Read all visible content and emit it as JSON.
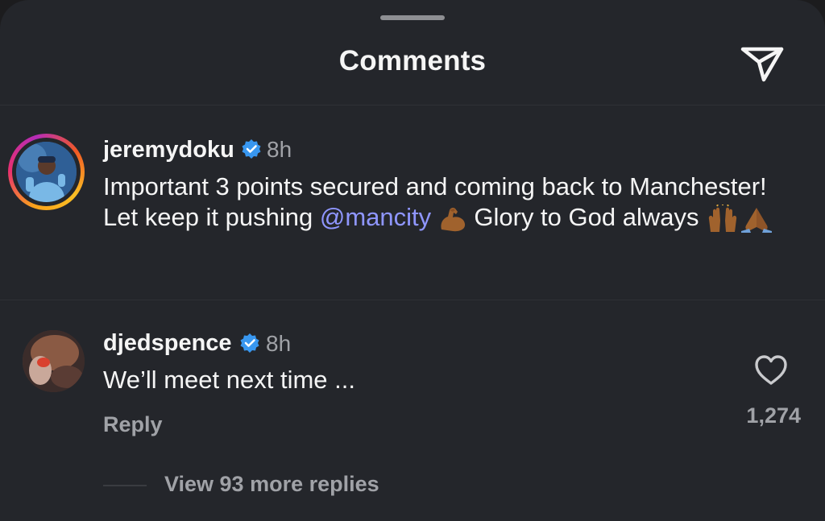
{
  "header": {
    "title": "Comments",
    "share_icon": "send-icon"
  },
  "comments": [
    {
      "username": "jeremydoku",
      "verified": true,
      "time": "8h",
      "text_before_mention": "Important 3 points secured and coming back to Manchester! Let keep it pushing ",
      "mention": "@mancity",
      "text_after_mention": " Glory to God always ",
      "emojis": [
        "flexed-biceps-icon",
        "raising-hands-icon",
        "folded-hands-icon"
      ]
    },
    {
      "username": "djedspence",
      "verified": true,
      "time": "8h",
      "text": "We’ll meet next time ...",
      "reply_label": "Reply",
      "like_count": "1,274",
      "view_replies_label": "View 93 more replies"
    }
  ],
  "colors": {
    "background": "#24262b",
    "text": "#f5f5f5",
    "muted": "#a0a2a7",
    "mention": "#8f96ff",
    "verified": "#3897f0"
  }
}
